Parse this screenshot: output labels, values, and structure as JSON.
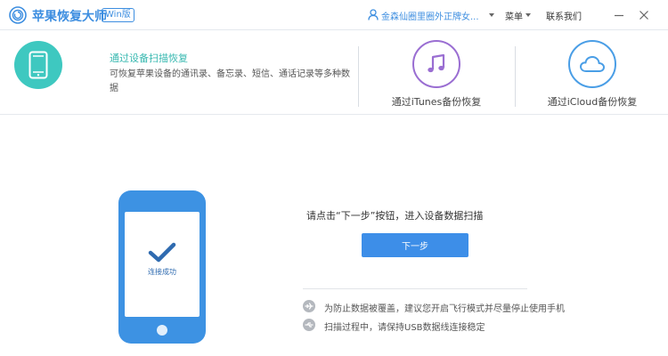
{
  "titlebar": {
    "app_name": "苹果恢复大师",
    "edition_badge": "Win版",
    "user_name": "金森仙圈里圈外正牌女...",
    "menu_label": "菜单",
    "contact_label": "联系我们"
  },
  "modes": {
    "device": {
      "title": "通过设备扫描恢复",
      "description": "可恢复苹果设备的通讯录、备忘录、短信、通话记录等多种数据",
      "icon": "phone-icon"
    },
    "itunes": {
      "label": "通过iTunes备份恢复",
      "icon": "music-note-icon"
    },
    "icloud": {
      "label": "通过iCloud备份恢复",
      "icon": "cloud-icon"
    }
  },
  "main": {
    "phone_status": "连接成功",
    "below_phone_text": "...",
    "instruction": "请点击“下一步”按钮，进入设备数据扫描",
    "next_button": "下一步",
    "tips": [
      {
        "icon": "airplane-icon",
        "text": "为防止数据被覆盖，建议您开启飞行模式并尽量停止使用手机"
      },
      {
        "icon": "usb-icon",
        "text": "扫描过程中，请保持USB数据线连接稳定"
      }
    ]
  },
  "colors": {
    "brand_blue": "#3d8ee0",
    "teal": "#3ec8c0",
    "itunes_purple": "#9a6ed2",
    "icloud_blue": "#4a9ee6",
    "button_blue": "#3d8ee8"
  }
}
